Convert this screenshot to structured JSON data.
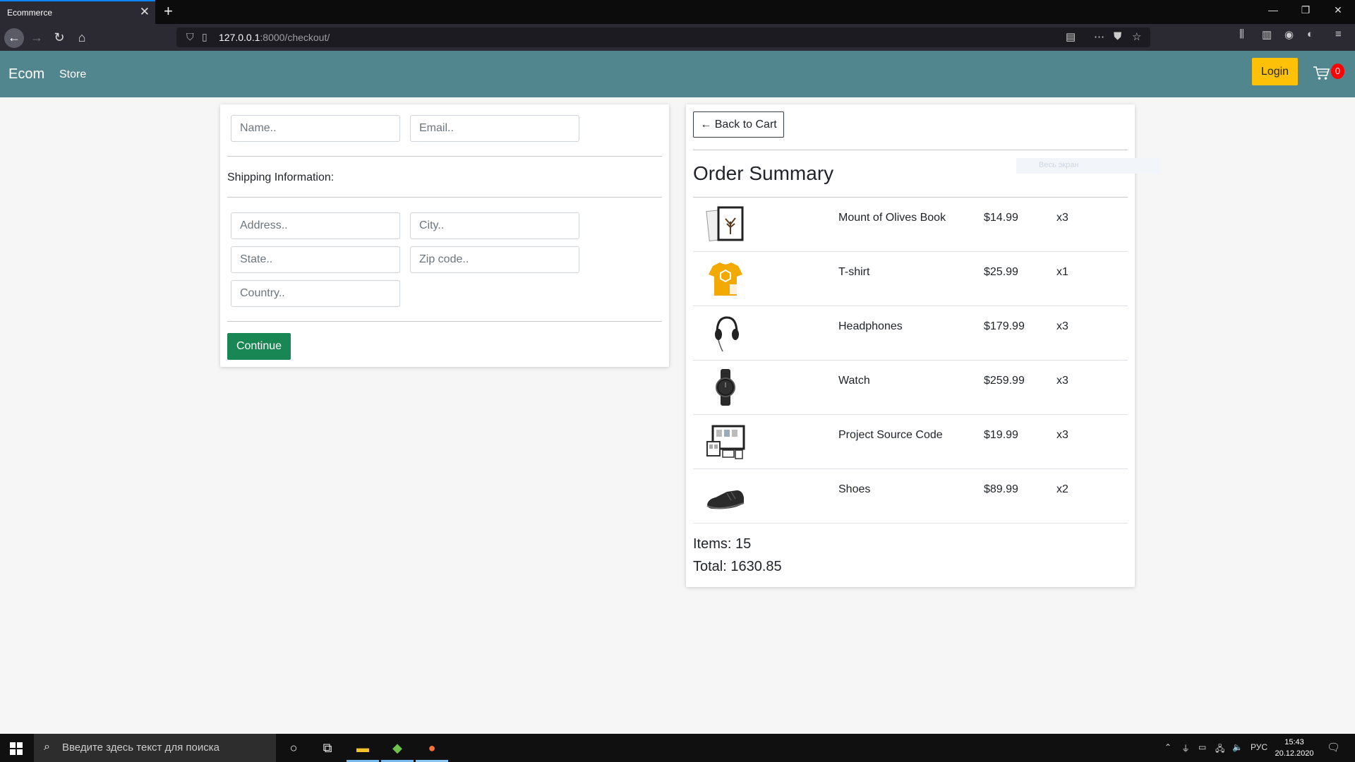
{
  "browser": {
    "tab_title": "Ecommerce",
    "tab_close": "✕",
    "new_tab": "+",
    "url_host": "127.0.0.1",
    "url_path": ":8000/checkout/"
  },
  "site": {
    "brand": "Ecom",
    "store_link": "Store",
    "login_label": "Login",
    "cart_count": "0"
  },
  "form": {
    "name_placeholder": "Name..",
    "email_placeholder": "Email..",
    "shipping_title": "Shipping Information:",
    "address_placeholder": "Address..",
    "city_placeholder": "City..",
    "state_placeholder": "State..",
    "zip_placeholder": "Zip code..",
    "country_placeholder": "Country..",
    "continue_label": "Continue"
  },
  "summary": {
    "back_label": "← Back to Cart",
    "title": "Order Summary",
    "ghost_text": "Весь экран",
    "items": [
      {
        "name": "Mount of Olives Book",
        "price": "$14.99",
        "qty": "x3",
        "icon": "book-icon"
      },
      {
        "name": "T-shirt",
        "price": "$25.99",
        "qty": "x1",
        "icon": "tshirt-icon"
      },
      {
        "name": "Headphones",
        "price": "$179.99",
        "qty": "x3",
        "icon": "headphones-icon"
      },
      {
        "name": "Watch",
        "price": "$259.99",
        "qty": "x3",
        "icon": "watch-icon"
      },
      {
        "name": "Project Source Code",
        "price": "$19.99",
        "qty": "x3",
        "icon": "monitor-icon"
      },
      {
        "name": "Shoes",
        "price": "$89.99",
        "qty": "x2",
        "icon": "shoe-icon"
      }
    ],
    "items_text": "Items: 15",
    "total_text": "Total: 1630.85"
  },
  "taskbar": {
    "search_placeholder": "Введите здесь текст для поиска",
    "lang": "РУС",
    "time": "15:43",
    "date": "20.12.2020"
  },
  "colors": {
    "nav": "#51868e",
    "login": "#ffc107",
    "continue": "#198754",
    "badge": "#ff0000"
  }
}
